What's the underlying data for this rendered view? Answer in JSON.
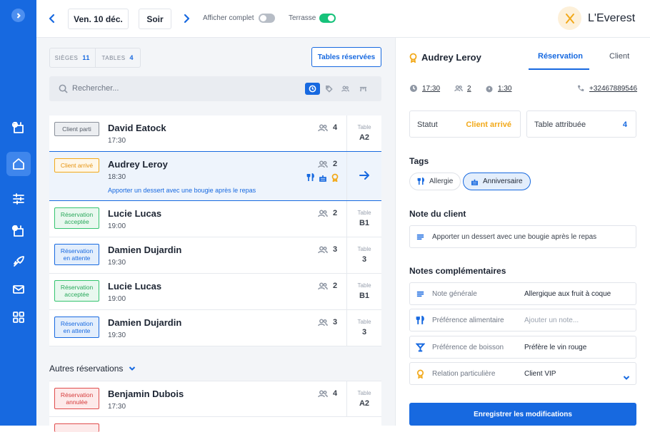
{
  "topbar": {
    "date_label": "Ven. 10 déc.",
    "service_label": "Soir",
    "show_full_label": "Afficher complet",
    "terrace_label": "Terrasse",
    "restaurant_name": "L'Everest"
  },
  "toggles": {
    "show_full": false,
    "terrace": true
  },
  "left": {
    "seats_label": "SIÈGES",
    "seats_count": "11",
    "tables_label": "TABLES",
    "tables_count": "4",
    "reserved_tables_button": "Tables réservées",
    "search_placeholder": "Rechercher...",
    "others_label": "Autres réservations"
  },
  "reservations": [
    {
      "status": "Client parti",
      "name": "David Eatock",
      "time": "17:30",
      "pax": "4",
      "table_label": "Table",
      "table": "A2"
    },
    {
      "status": "Client arrivé",
      "name": "Audrey Leroy",
      "time": "18:30",
      "pax": "2",
      "note": "Apporter un dessert avec une bougie après le repas"
    },
    {
      "status_line1": "Réservation",
      "status_line2": "acceptée",
      "name": "Lucie Lucas",
      "time": "19:00",
      "pax": "2",
      "table_label": "Table",
      "table": "B1"
    },
    {
      "status_line1": "Réservation",
      "status_line2": "en attente",
      "name": "Damien Dujardin",
      "time": "19:30",
      "pax": "3",
      "table_label": "Table",
      "table": "3"
    },
    {
      "status_line1": "Réservation",
      "status_line2": "acceptée",
      "name": "Lucie Lucas",
      "time": "19:00",
      "pax": "2",
      "table_label": "Table",
      "table": "B1"
    },
    {
      "status_line1": "Réservation",
      "status_line2": "en attente",
      "name": "Damien Dujardin",
      "time": "19:30",
      "pax": "3",
      "table_label": "Table",
      "table": "3"
    }
  ],
  "other_reservations": [
    {
      "status_line1": "Réservation",
      "status_line2": "annulée",
      "name": "Benjamin Dubois",
      "time": "17:30",
      "pax": "4",
      "table_label": "Table",
      "table": "A2"
    }
  ],
  "detail": {
    "client_name": "Audrey Leroy",
    "tab_reservation": "Réservation",
    "tab_client": "Client",
    "time": "17:30",
    "pax": "2",
    "duration": "1:30",
    "phone": "+32467889546",
    "status_label": "Statut",
    "status_value": "Client arrivé",
    "table_label": "Table attribuée",
    "table_value": "4",
    "tags_title": "Tags",
    "tags": [
      "Allergie",
      "Anniversaire"
    ],
    "client_note_title": "Note du client",
    "client_note": "Apporter un dessert avec une bougie après le repas",
    "extra_notes_title": "Notes complémentaires",
    "notes": [
      {
        "label": "Note générale",
        "value": "Allergique aux fruit à coque"
      },
      {
        "label": "Préférence alimentaire",
        "placeholder": "Ajouter un note..."
      },
      {
        "label": "Préférence de boisson",
        "value": "Préfère le vin rouge"
      },
      {
        "label": "Relation particulière",
        "value": "Client VIP"
      }
    ],
    "save_button": "Enregistrer les modifications"
  },
  "colors": {
    "primary": "#1769e0",
    "arrived": "#f2a91a",
    "accepted": "#34c46f",
    "cancelled": "#e04c4c",
    "toggle_on": "#16c27a",
    "toggle_off": "#b7bdc6"
  }
}
